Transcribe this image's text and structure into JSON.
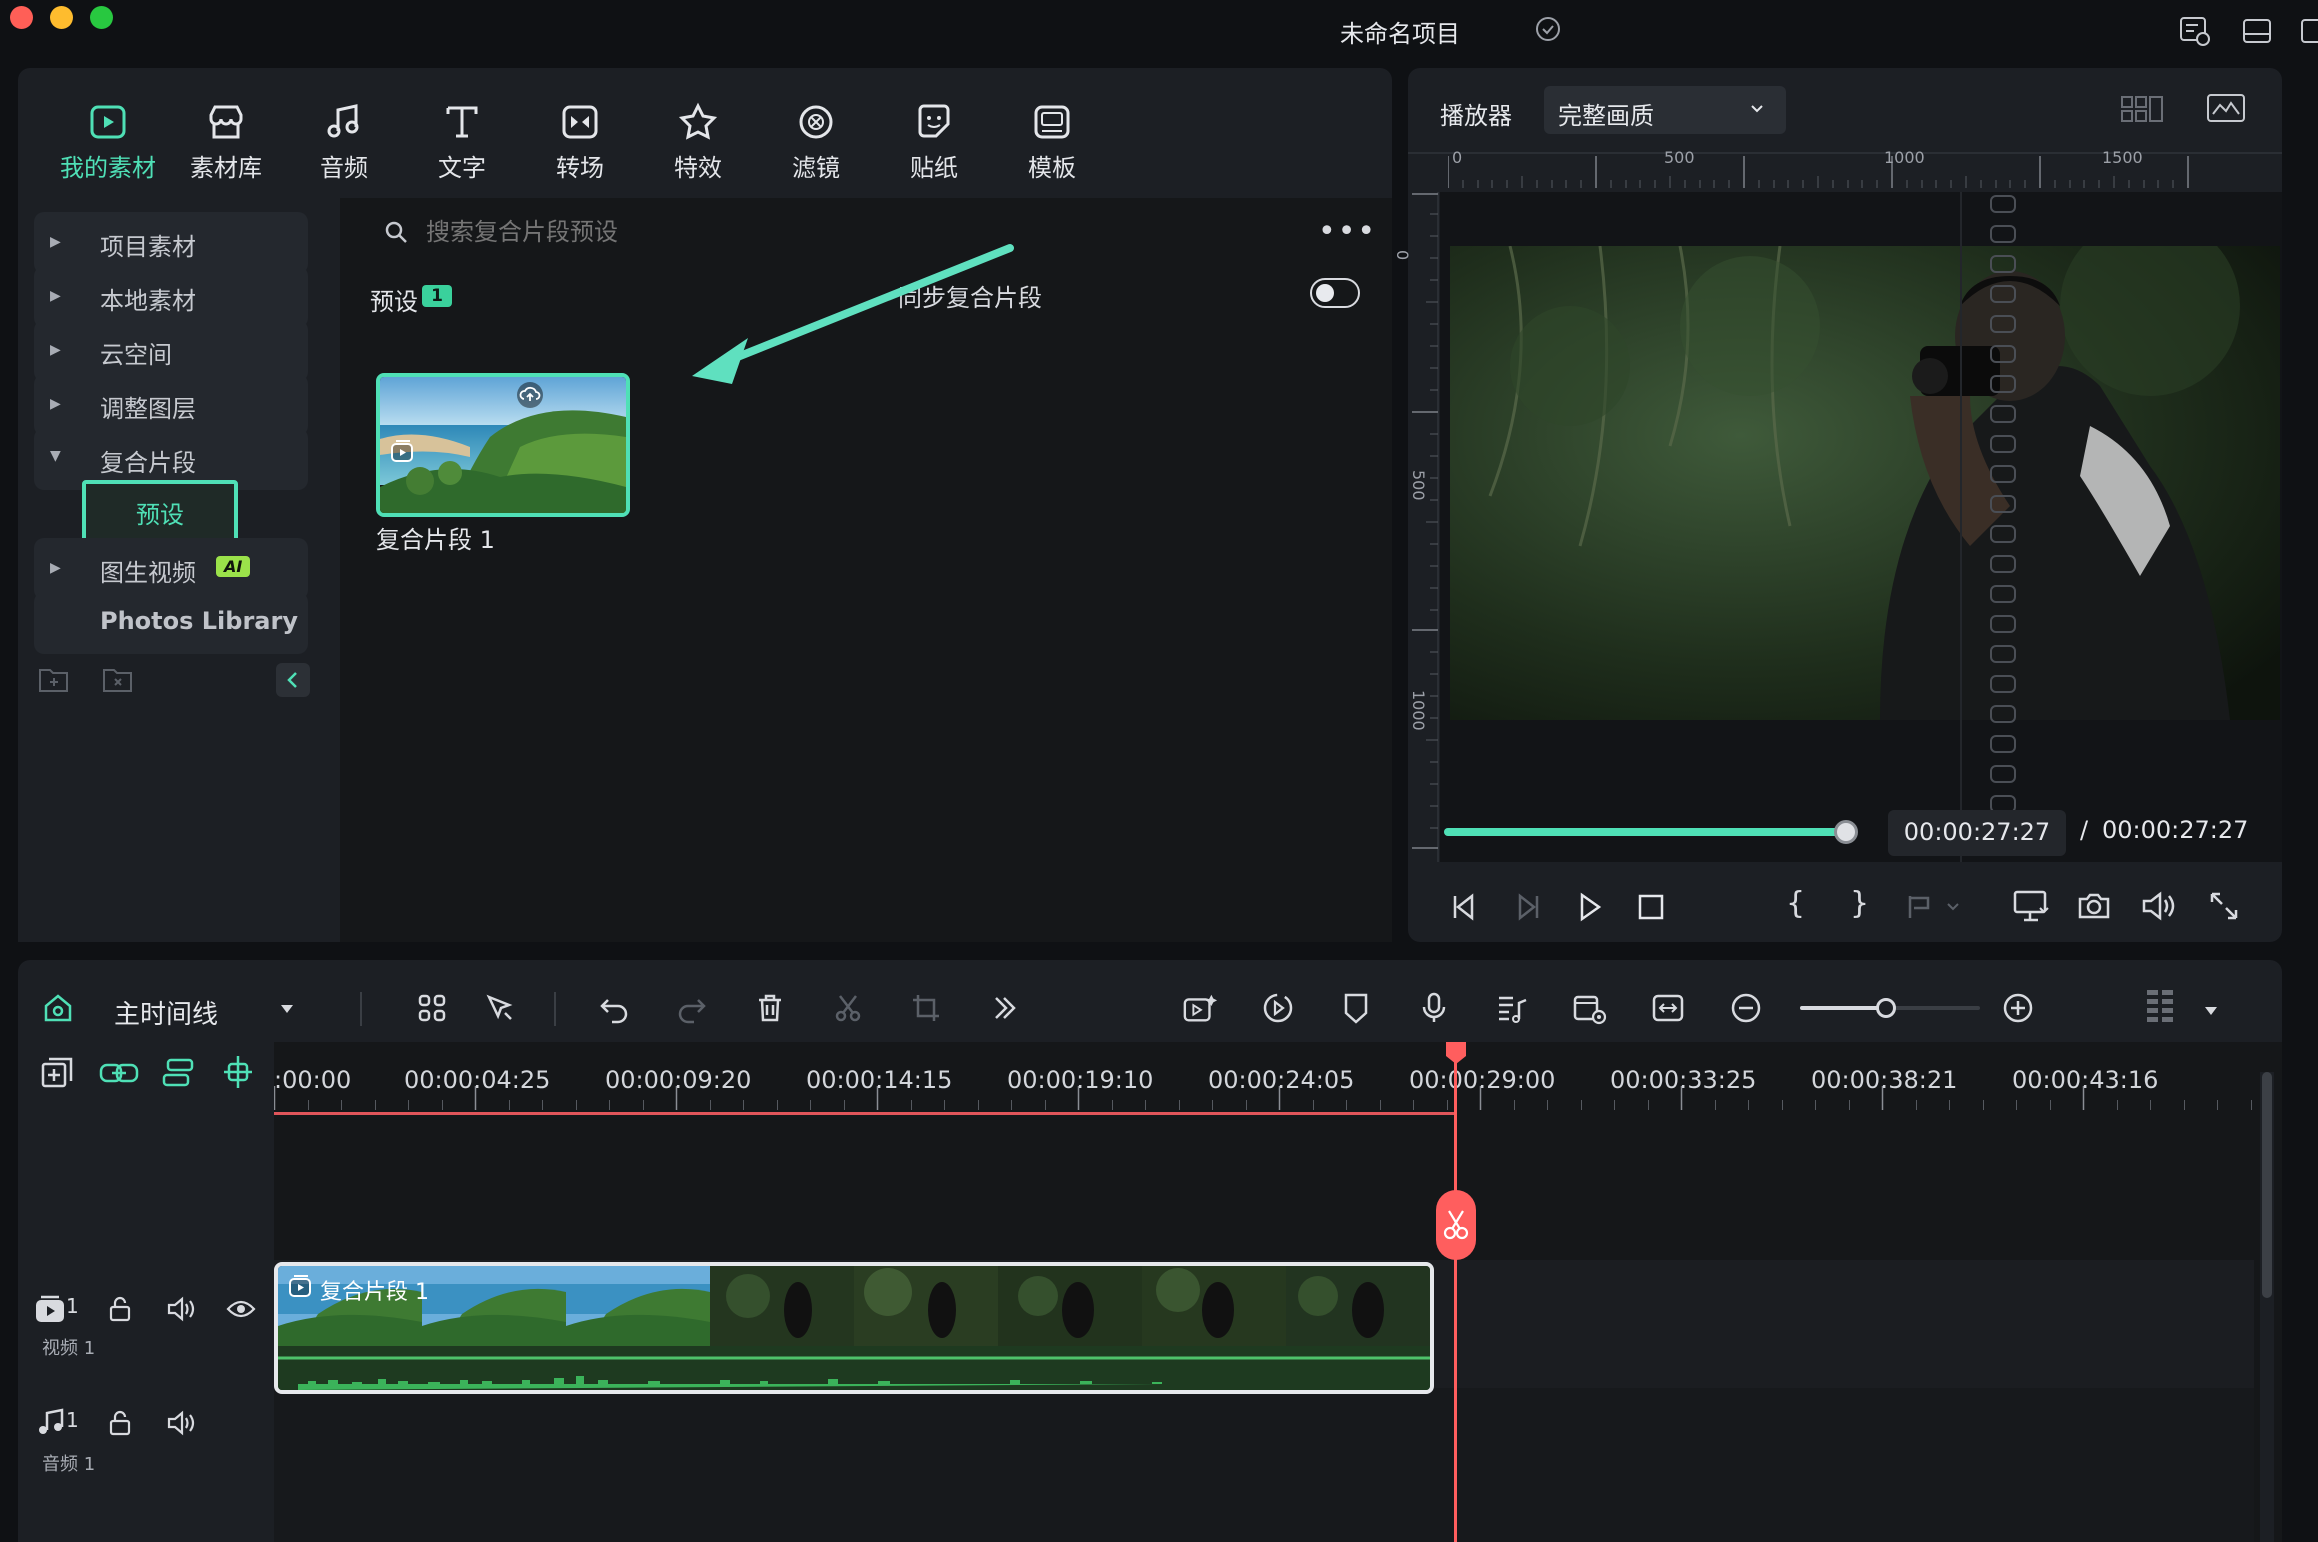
{
  "window": {
    "project_title": "未命名项目",
    "traffic_lights": {
      "close": "#ff5f57",
      "minimize": "#febc2e",
      "maximize": "#28c840"
    }
  },
  "colors": {
    "accent": "#4fe0b6",
    "playhead": "#ff5e5e",
    "panel": "#1c1f24"
  },
  "media_tabs": [
    {
      "label": "我的素材",
      "icon": "my-media-icon",
      "active": true
    },
    {
      "label": "素材库",
      "icon": "stock-library-icon"
    },
    {
      "label": "音频",
      "icon": "audio-note-icon"
    },
    {
      "label": "文字",
      "icon": "text-t-icon"
    },
    {
      "label": "转场",
      "icon": "transition-icon"
    },
    {
      "label": "特效",
      "icon": "effects-star-icon"
    },
    {
      "label": "滤镜",
      "icon": "filter-icon"
    },
    {
      "label": "贴纸",
      "icon": "sticker-icon"
    },
    {
      "label": "模板",
      "icon": "template-icon"
    }
  ],
  "sidebar": {
    "items": [
      {
        "label": "项目素材"
      },
      {
        "label": "本地素材"
      },
      {
        "label": "云空间"
      },
      {
        "label": "调整图层"
      },
      {
        "label": "复合片段",
        "expanded": true
      },
      {
        "label": "图生视频",
        "badge": "AI"
      },
      {
        "label": "Photos Library"
      }
    ],
    "sub_item": "预设"
  },
  "content": {
    "search_placeholder": "搜索复合片段预设",
    "section_title": "预设",
    "section_count": "1",
    "sync_label": "同步复合片段",
    "sync_on": false,
    "clip_name": "复合片段 1"
  },
  "player": {
    "title": "播放器",
    "quality": "完整画质",
    "ruler_h": [
      "0",
      "500",
      "1000",
      "1500"
    ],
    "ruler_v": [
      "0",
      "500",
      "1000"
    ],
    "current_time": "00:00:27:27",
    "separator": "/",
    "total_time": "00:00:27:27",
    "progress": 1.0
  },
  "timeline": {
    "title": "主时间线",
    "ruler": [
      ":00:00",
      "00:00:04:25",
      "00:00:09:20",
      "00:00:14:15",
      "00:00:19:10",
      "00:00:24:05",
      "00:00:29:00",
      "00:00:33:25",
      "00:00:38:21",
      "00:00:43:16"
    ],
    "video_track": {
      "index": "1",
      "label": "视频 1"
    },
    "audio_track": {
      "index": "1",
      "label": "音频 1"
    },
    "clip_label": "复合片段 1",
    "zoom_level": 0.48
  }
}
